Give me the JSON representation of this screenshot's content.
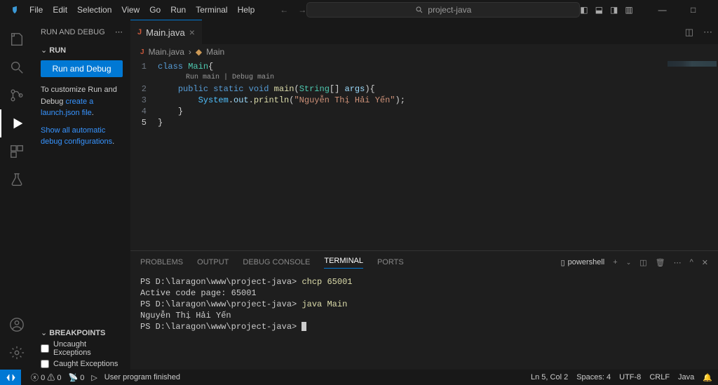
{
  "titlebar": {
    "menus": [
      "File",
      "Edit",
      "Selection",
      "View",
      "Go",
      "Run",
      "Terminal",
      "Help"
    ],
    "search_placeholder": "project-java"
  },
  "sidebar": {
    "header": "RUN AND DEBUG",
    "section_run": "RUN",
    "run_button": "Run and Debug",
    "customize_text": "To customize Run and Debug ",
    "customize_link": "create a launch.json file",
    "auto_link": "Show all automatic debug configurations",
    "breakpoints_title": "BREAKPOINTS",
    "bp1": "Uncaught Exceptions",
    "bp2": "Caught Exceptions"
  },
  "editor": {
    "tab_name": "Main.java",
    "breadcrumb_file": "Main.java",
    "breadcrumb_class": "Main",
    "codelens": "Run main | Debug main",
    "code": {
      "l1_class": "class",
      "l1_name": "Main",
      "l2_public": "public",
      "l2_static": "static",
      "l2_void": "void",
      "l2_main": "main",
      "l2_string": "String",
      "l2_args": "args",
      "l3_system": "System",
      "l3_out": "out",
      "l3_println": "println",
      "l3_str": "\"Nguyễn Thị Hải Yến\""
    }
  },
  "panel": {
    "tabs": [
      "PROBLEMS",
      "OUTPUT",
      "DEBUG CONSOLE",
      "TERMINAL",
      "PORTS"
    ],
    "shell": "powershell",
    "lines": {
      "prompt": "PS D:\\laragon\\www\\project-java>",
      "cmd1": "chcp 65001",
      "out1": "Active code page: 65001",
      "cmd2": "java Main",
      "out2": "Nguyễn Thị Hải Yến"
    }
  },
  "statusbar": {
    "errors": "0",
    "warnings": "0",
    "ports": "0",
    "msg": "User program finished",
    "lncol": "Ln 5, Col 2",
    "spaces": "Spaces: 4",
    "enc": "UTF-8",
    "eol": "CRLF",
    "lang": "Java"
  }
}
